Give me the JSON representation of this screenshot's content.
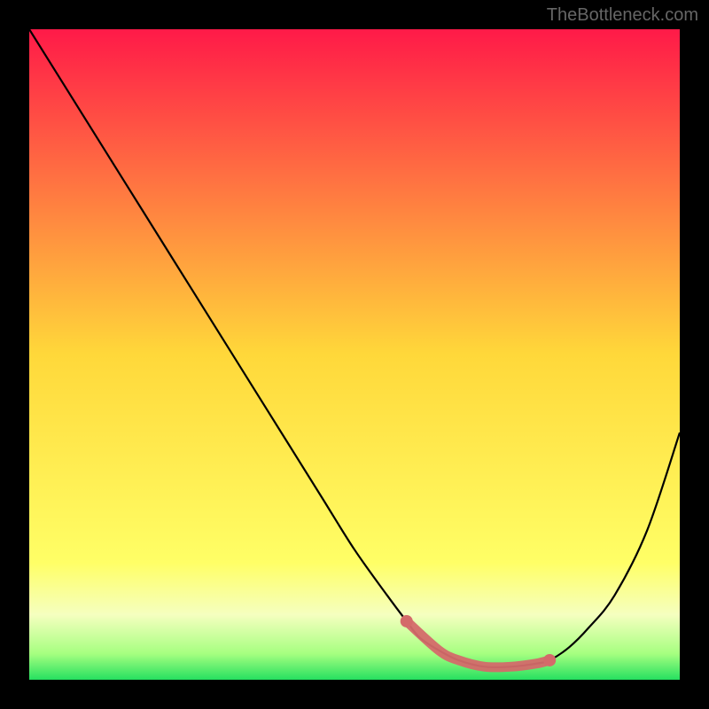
{
  "watermark": "TheBottleneck.com",
  "chart_data": {
    "type": "line",
    "title": "",
    "xlabel": "",
    "ylabel": "",
    "xlim": [
      0,
      100
    ],
    "ylim": [
      0,
      100
    ],
    "series": [
      {
        "name": "bottleneck-curve",
        "x": [
          0,
          5,
          10,
          15,
          20,
          25,
          30,
          35,
          40,
          45,
          50,
          55,
          58,
          60,
          63,
          66,
          70,
          74,
          78,
          80,
          83,
          86,
          90,
          95,
          100
        ],
        "y": [
          100,
          92,
          84,
          76,
          68,
          60,
          52,
          44,
          36,
          28,
          20,
          13,
          9,
          6.5,
          4.5,
          3,
          2,
          2,
          2.5,
          3,
          5,
          8,
          13,
          23,
          38
        ],
        "color": "#000000"
      },
      {
        "name": "highlight-markers",
        "type": "scatter",
        "x": [
          58,
          63,
          66,
          70,
          74,
          78,
          80
        ],
        "y": [
          9,
          4.5,
          3,
          2,
          2,
          2.5,
          3
        ],
        "color": "#d46a6a"
      }
    ],
    "background": {
      "type": "vertical-gradient",
      "stops": [
        {
          "pos": 0.0,
          "color": "#ff1a48"
        },
        {
          "pos": 0.5,
          "color": "#ffd83a"
        },
        {
          "pos": 0.82,
          "color": "#ffff66"
        },
        {
          "pos": 0.9,
          "color": "#f5ffbf"
        },
        {
          "pos": 0.96,
          "color": "#a6ff80"
        },
        {
          "pos": 1.0,
          "color": "#26e060"
        }
      ]
    }
  }
}
